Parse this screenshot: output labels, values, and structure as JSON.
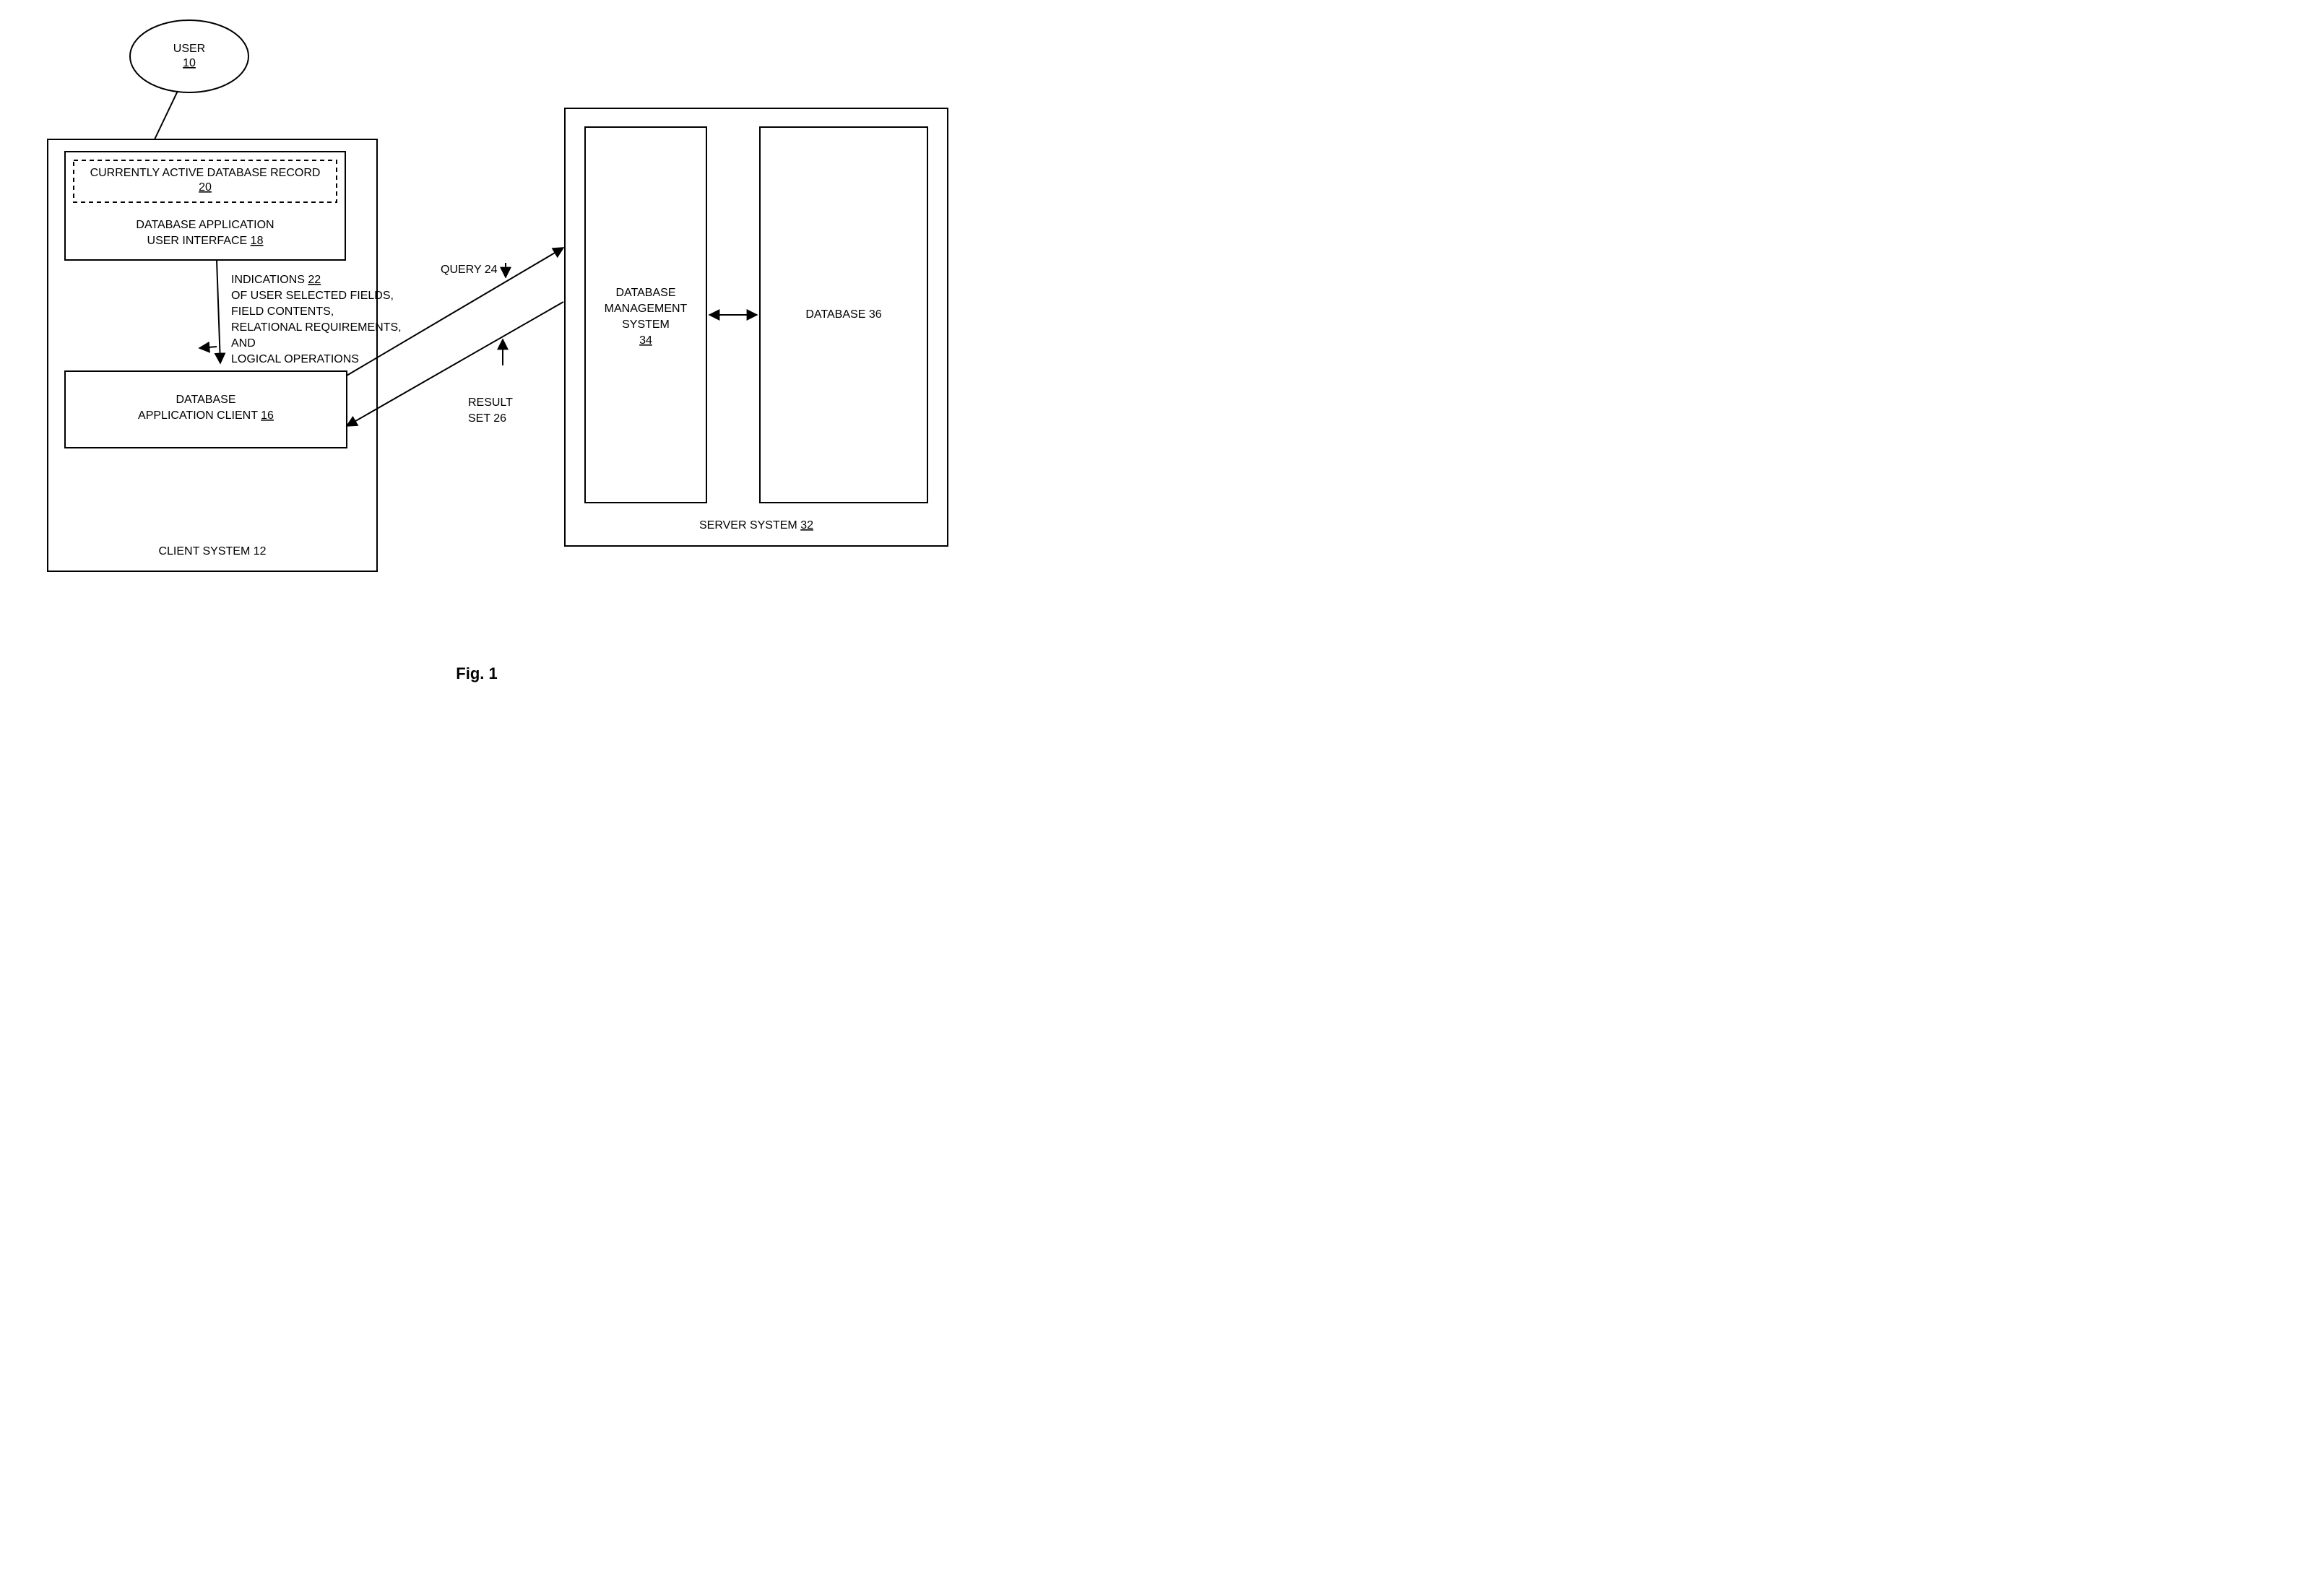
{
  "figure_label": "Fig. 1",
  "user": {
    "label": "USER",
    "ref": "10"
  },
  "client_system": {
    "label": "CLIENT SYSTEM",
    "ref": "12",
    "ui_box": {
      "line1": "DATABASE APPLICATION",
      "line2": "USER INTERFACE",
      "ref": "18",
      "record": {
        "label": "CURRENTLY ACTIVE DATABASE RECORD",
        "ref": "20"
      }
    },
    "client_box": {
      "line1": "DATABASE",
      "line2": "APPLICATION CLIENT",
      "ref": "16"
    },
    "indications": {
      "line1": "INDICATIONS",
      "ref": "22",
      "line2": "OF USER SELECTED FIELDS,",
      "line3": "FIELD CONTENTS,",
      "line4": "RELATIONAL REQUIREMENTS,",
      "line5": "AND",
      "line6": "LOGICAL OPERATIONS"
    }
  },
  "query": {
    "label": "QUERY",
    "ref": "24"
  },
  "result": {
    "line1": "RESULT",
    "line2": "SET",
    "ref": "26"
  },
  "server_system": {
    "label": "SERVER SYSTEM",
    "ref": "32",
    "dbms": {
      "line1": "DATABASE",
      "line2": "MANAGEMENT",
      "line3": "SYSTEM",
      "ref": "34"
    },
    "database": {
      "label": "DATABASE",
      "ref": "36"
    }
  }
}
